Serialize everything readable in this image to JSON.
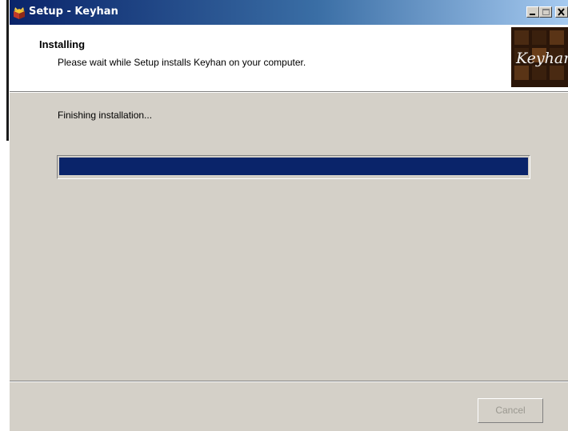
{
  "window": {
    "title": "Setup - Keyhan",
    "app_icon": "setup-box-icon",
    "buttons": [
      "minimize-icon",
      "maximize-icon",
      "close-icon"
    ]
  },
  "header": {
    "title": "Installing",
    "subtitle": "Please wait while Setup installs Keyhan on your computer.",
    "logo_text": "Keyhan"
  },
  "main": {
    "status": "Finishing installation...",
    "progress_fraction": 1.0
  },
  "footer": {
    "cancel_label": "Cancel",
    "cancel_enabled": false
  },
  "colors": {
    "titlebar_start": "#0a246a",
    "titlebar_end": "#a6caf0",
    "progress_fill": "#0a246a",
    "window_bg": "#d4d0c8"
  }
}
